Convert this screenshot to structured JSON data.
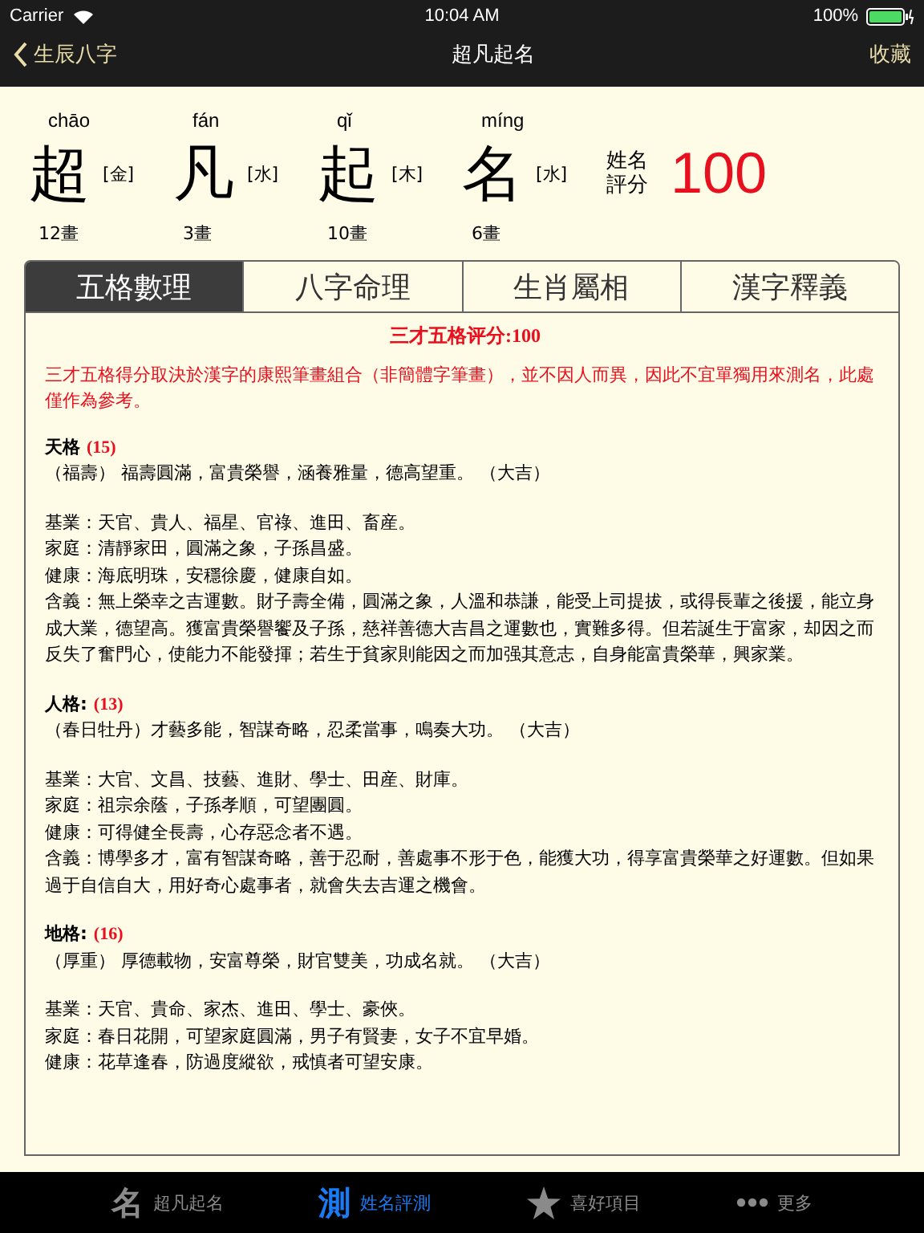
{
  "status_bar": {
    "carrier": "Carrier",
    "time": "10:04 AM",
    "battery": "100%"
  },
  "nav": {
    "back": "生辰八字",
    "title": "超凡起名",
    "action": "收藏"
  },
  "name_chars": [
    {
      "pinyin": "chāo",
      "char": "超",
      "element": "[金]",
      "strokes": "12畫"
    },
    {
      "pinyin": "fán",
      "char": "凡",
      "element": "[水]",
      "strokes": "3畫"
    },
    {
      "pinyin": "qǐ",
      "char": "起",
      "element": "[木]",
      "strokes": "10畫"
    },
    {
      "pinyin": "míng",
      "char": "名",
      "element": "[水]",
      "strokes": "6畫"
    }
  ],
  "score": {
    "label": "姓名評分",
    "value": "100"
  },
  "tabs": [
    {
      "label": "五格數理",
      "selected": true
    },
    {
      "label": "八字命理",
      "selected": false
    },
    {
      "label": "生肖屬相",
      "selected": false
    },
    {
      "label": "漢字釋義",
      "selected": false
    }
  ],
  "content": {
    "heading": "三才五格评分:100",
    "notice": "三才五格得分取決於漢字的康熙筆畫組合（非簡體字筆畫），並不因人而異，因此不宜單獨用來測名，此處僅作為參考。",
    "sections": [
      {
        "title": "天格",
        "score": "(15)",
        "summary": "（福壽） 福壽圓滿，富貴榮譽，涵養雅量，德高望重。 （大吉）",
        "lines": [
          "基業：天官、貴人、福星、官祿、進田、畜産。",
          "家庭：清靜家田，圓滿之象，子孫昌盛。",
          "健康：海底明珠，安穩徐慶，健康自如。",
          "含義：無上榮幸之吉運數。財子壽全備，圓滿之象，人溫和恭謙，能受上司提拔，或得長輩之後援，能立身成大業，德望高。獲富貴榮譽饗及子孫，慈祥善德大吉昌之運數也，實難多得。但若誕生于富家，却因之而反失了奮門心，使能力不能發揮；若生于貧家則能因之而加强其意志，自身能富貴榮華，興家業。"
        ]
      },
      {
        "title": "人格:",
        "score": "(13)",
        "summary": "（春日牡丹）才藝多能，智謀奇略，忍柔當事，鳴奏大功。 （大吉）",
        "lines": [
          "基業：大官、文昌、技藝、進財、學士、田産、財庫。",
          "家庭：祖宗余蔭，子孫孝順，可望團圓。",
          "健康：可得健全長壽，心存惡念者不遇。",
          "含義：博學多才，富有智謀奇略，善于忍耐，善處事不形于色，能獲大功，得享富貴榮華之好運數。但如果過于自信自大，用好奇心處事者，就會失去吉運之機會。"
        ]
      },
      {
        "title": "地格:",
        "score": "(16)",
        "summary": "（厚重） 厚德載物，安富尊榮，財官雙美，功成名就。 （大吉）",
        "lines": [
          "基業：天官、貴命、家杰、進田、學士、豪俠。",
          "家庭：春日花開，可望家庭圓滿，男子有賢妻，女子不宜早婚。",
          "健康：花草逢春，防過度縱欲，戒慎者可望安康。"
        ]
      }
    ]
  },
  "tab_bar": [
    {
      "kind": "glyph",
      "glyph": "名",
      "label": "超凡起名",
      "selected": false
    },
    {
      "kind": "glyph",
      "glyph": "測",
      "label": "姓名評測",
      "selected": true
    },
    {
      "kind": "star",
      "label": "喜好項目",
      "selected": false
    },
    {
      "kind": "dots",
      "label": "更多",
      "selected": false
    }
  ]
}
